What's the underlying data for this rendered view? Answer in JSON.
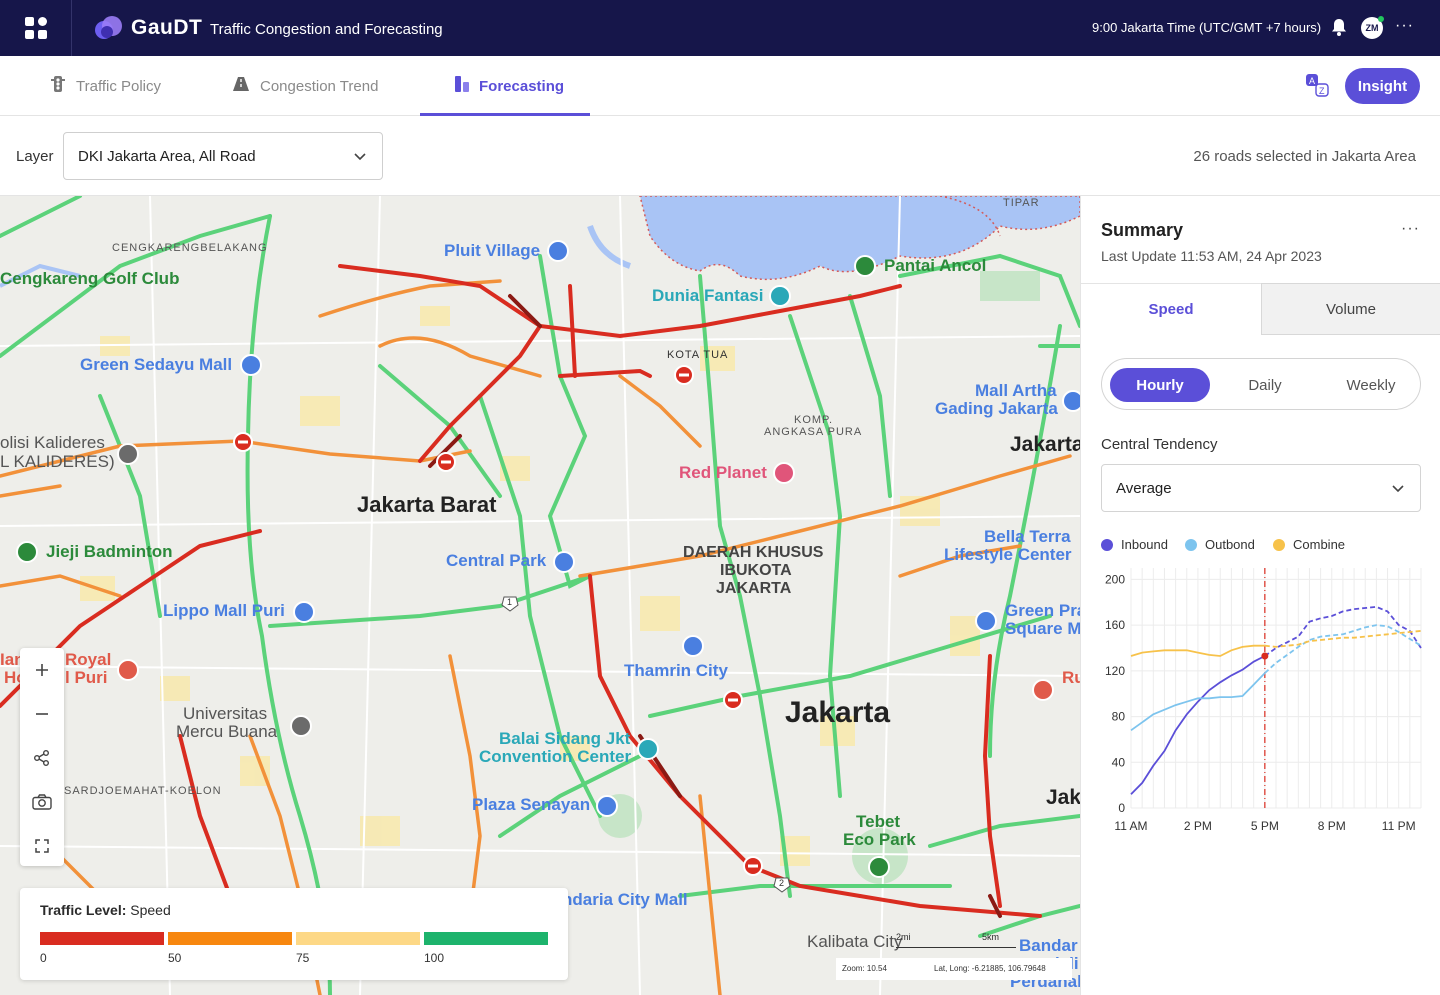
{
  "header": {
    "brand": "GauDΤ",
    "app_title": "Traffic Congestion and Forecasting",
    "time": "9:00 Jakarta Time (UTC/GMT +7 hours)",
    "avatar_initials": "ZM",
    "more": "···"
  },
  "tabs": [
    {
      "label": "Traffic Policy",
      "icon": "traffic-light-icon"
    },
    {
      "label": "Congestion Trend",
      "icon": "road-icon"
    },
    {
      "label": "Forecasting",
      "icon": "forecast-icon",
      "active": true
    }
  ],
  "insight_label": "Insight",
  "layer": {
    "label": "Layer",
    "value": "DKI Jakarta Area, All Road",
    "roads_count": "26 roads selected in Jakarta Area"
  },
  "map": {
    "labels": {
      "cengkareng": "CENGKARENGBELAKANG",
      "golf": "Cengkareng Golf Club",
      "pluit": "Pluit Village",
      "tipar": "TIPAR",
      "ancol": "Pantai Ancol",
      "dufan": "Dunia Fantasi",
      "green_sedayu": "Green Sedayu Mall",
      "kota_tua": "KOTA TUA",
      "kalideres1": "olisi Kalideres",
      "kalideres2": "L KALIDERES)",
      "komp1": "KOMP.",
      "komp2": "ANGKASA PURA",
      "mall_artha1": "Mall Artha",
      "mall_artha2": "Gading Jakarta",
      "jakarta_right": "Jakarta",
      "red_planet": "Red Planet",
      "jakbar": "Jakarta Barat",
      "jieji": "Jieji Badminton",
      "bella1": "Bella Terra",
      "bella2": "Lifestyle Center",
      "central_park": "Central Park",
      "dki1": "DAERAH KHUSUS",
      "dki2": "IBUKOTA",
      "dki3": "JAKARTA",
      "lippo": "Lippo Mall Puri",
      "green_pra1": "Green Pra",
      "green_pra2": "Square M",
      "royal1": "Royal",
      "royal2": "l Puri",
      "royal_h1": "Ian",
      "royal_h2": "Ho",
      "thamrin": "Thamrin City",
      "ru": "Ru",
      "jakarta": "Jakarta",
      "umb1": "Universitas",
      "umb2": "Mercu Buana",
      "balai1": "Balai Sidang Jkt",
      "balai2": "Convention Center",
      "sardjo": "SARDJOEMAHAT-KOELON",
      "jak": "Jak",
      "senayan": "Plaza Senayan",
      "tebet1": "Tebet",
      "tebet2": "Eco Park",
      "gandaria": "ndaria City Mall",
      "kalibata": "Kalibata City",
      "bandar1": "Bandar",
      "bandar2": "lali",
      "perdanakus": "Perdanakus",
      "route1": "1",
      "route2": "2"
    },
    "scale_mi": "2mi",
    "scale_km": "5km",
    "zoom": "Zoom: 10.54",
    "latlong": "Lat, Long: -6.21885, 106.79648"
  },
  "traffic_legend": {
    "title_bold": "Traffic Level:",
    "title_rest": " Speed",
    "ticks": [
      "0",
      "50",
      "75",
      "100"
    ],
    "colors": [
      "#d92c20",
      "#f7870f",
      "#fdd886",
      "#1db36c"
    ]
  },
  "summary": {
    "title": "Summary",
    "last_update": "Last Update 11:53 AM, 24 Apr 2023",
    "tabs": [
      "Speed",
      "Volume"
    ],
    "periods": [
      "Hourly",
      "Daily",
      "Weekly"
    ],
    "central_tendency_label": "Central Tendency",
    "central_tendency_value": "Average",
    "series_names": [
      "Inbound",
      "Outbond",
      "Combine"
    ],
    "series_colors": [
      "#5b4fd8",
      "#7dc4ee",
      "#f7c24a"
    ]
  },
  "chart_data": {
    "type": "line",
    "x_ticks": [
      "11 AM",
      "2 PM",
      "5 PM",
      "8 PM",
      "11 PM"
    ],
    "y_ticks": [
      0,
      40,
      80,
      120,
      160,
      200
    ],
    "ylim": [
      0,
      210
    ],
    "current_time_marker": "5 PM",
    "series": [
      {
        "name": "Inbound",
        "x": [
          0,
          0.5,
          1,
          1.5,
          2,
          2.5,
          3,
          3.5,
          4,
          4.5,
          5,
          5.5,
          6,
          6.5,
          7,
          7.5,
          8,
          8.5,
          9,
          9.5,
          10,
          10.5,
          11,
          11.5,
          12,
          12.5,
          13
        ],
        "values": [
          12,
          22,
          37,
          50,
          68,
          82,
          93,
          103,
          110,
          116,
          121,
          128,
          133,
          140,
          145,
          150,
          163,
          166,
          168,
          172,
          174,
          175,
          176,
          172,
          160,
          155,
          140
        ]
      },
      {
        "name": "Outbond",
        "x": [
          0,
          0.5,
          1,
          1.5,
          2,
          2.5,
          3,
          3.5,
          4,
          4.5,
          5,
          5.5,
          6,
          6.5,
          7,
          7.5,
          8,
          8.5,
          9,
          9.5,
          10,
          10.5,
          11,
          11.5,
          12,
          12.5,
          13
        ],
        "values": [
          68,
          75,
          82,
          86,
          90,
          93,
          96,
          96,
          97,
          97,
          98,
          108,
          118,
          127,
          134,
          141,
          147,
          150,
          151,
          152,
          155,
          158,
          160,
          159,
          154,
          148,
          142
        ]
      },
      {
        "name": "Combine",
        "x": [
          0,
          0.5,
          1,
          1.5,
          2,
          2.5,
          3,
          3.5,
          4,
          4.5,
          5,
          5.5,
          6,
          6.5,
          7,
          7.5,
          8,
          8.5,
          9,
          9.5,
          10,
          10.5,
          11,
          11.5,
          12,
          12.5,
          13
        ],
        "values": [
          133,
          136,
          137,
          138,
          138,
          138,
          136,
          134,
          133,
          138,
          141,
          142,
          142,
          141,
          142,
          143,
          146,
          147,
          148,
          149,
          149,
          150,
          151,
          152,
          153,
          154,
          155
        ]
      }
    ]
  }
}
